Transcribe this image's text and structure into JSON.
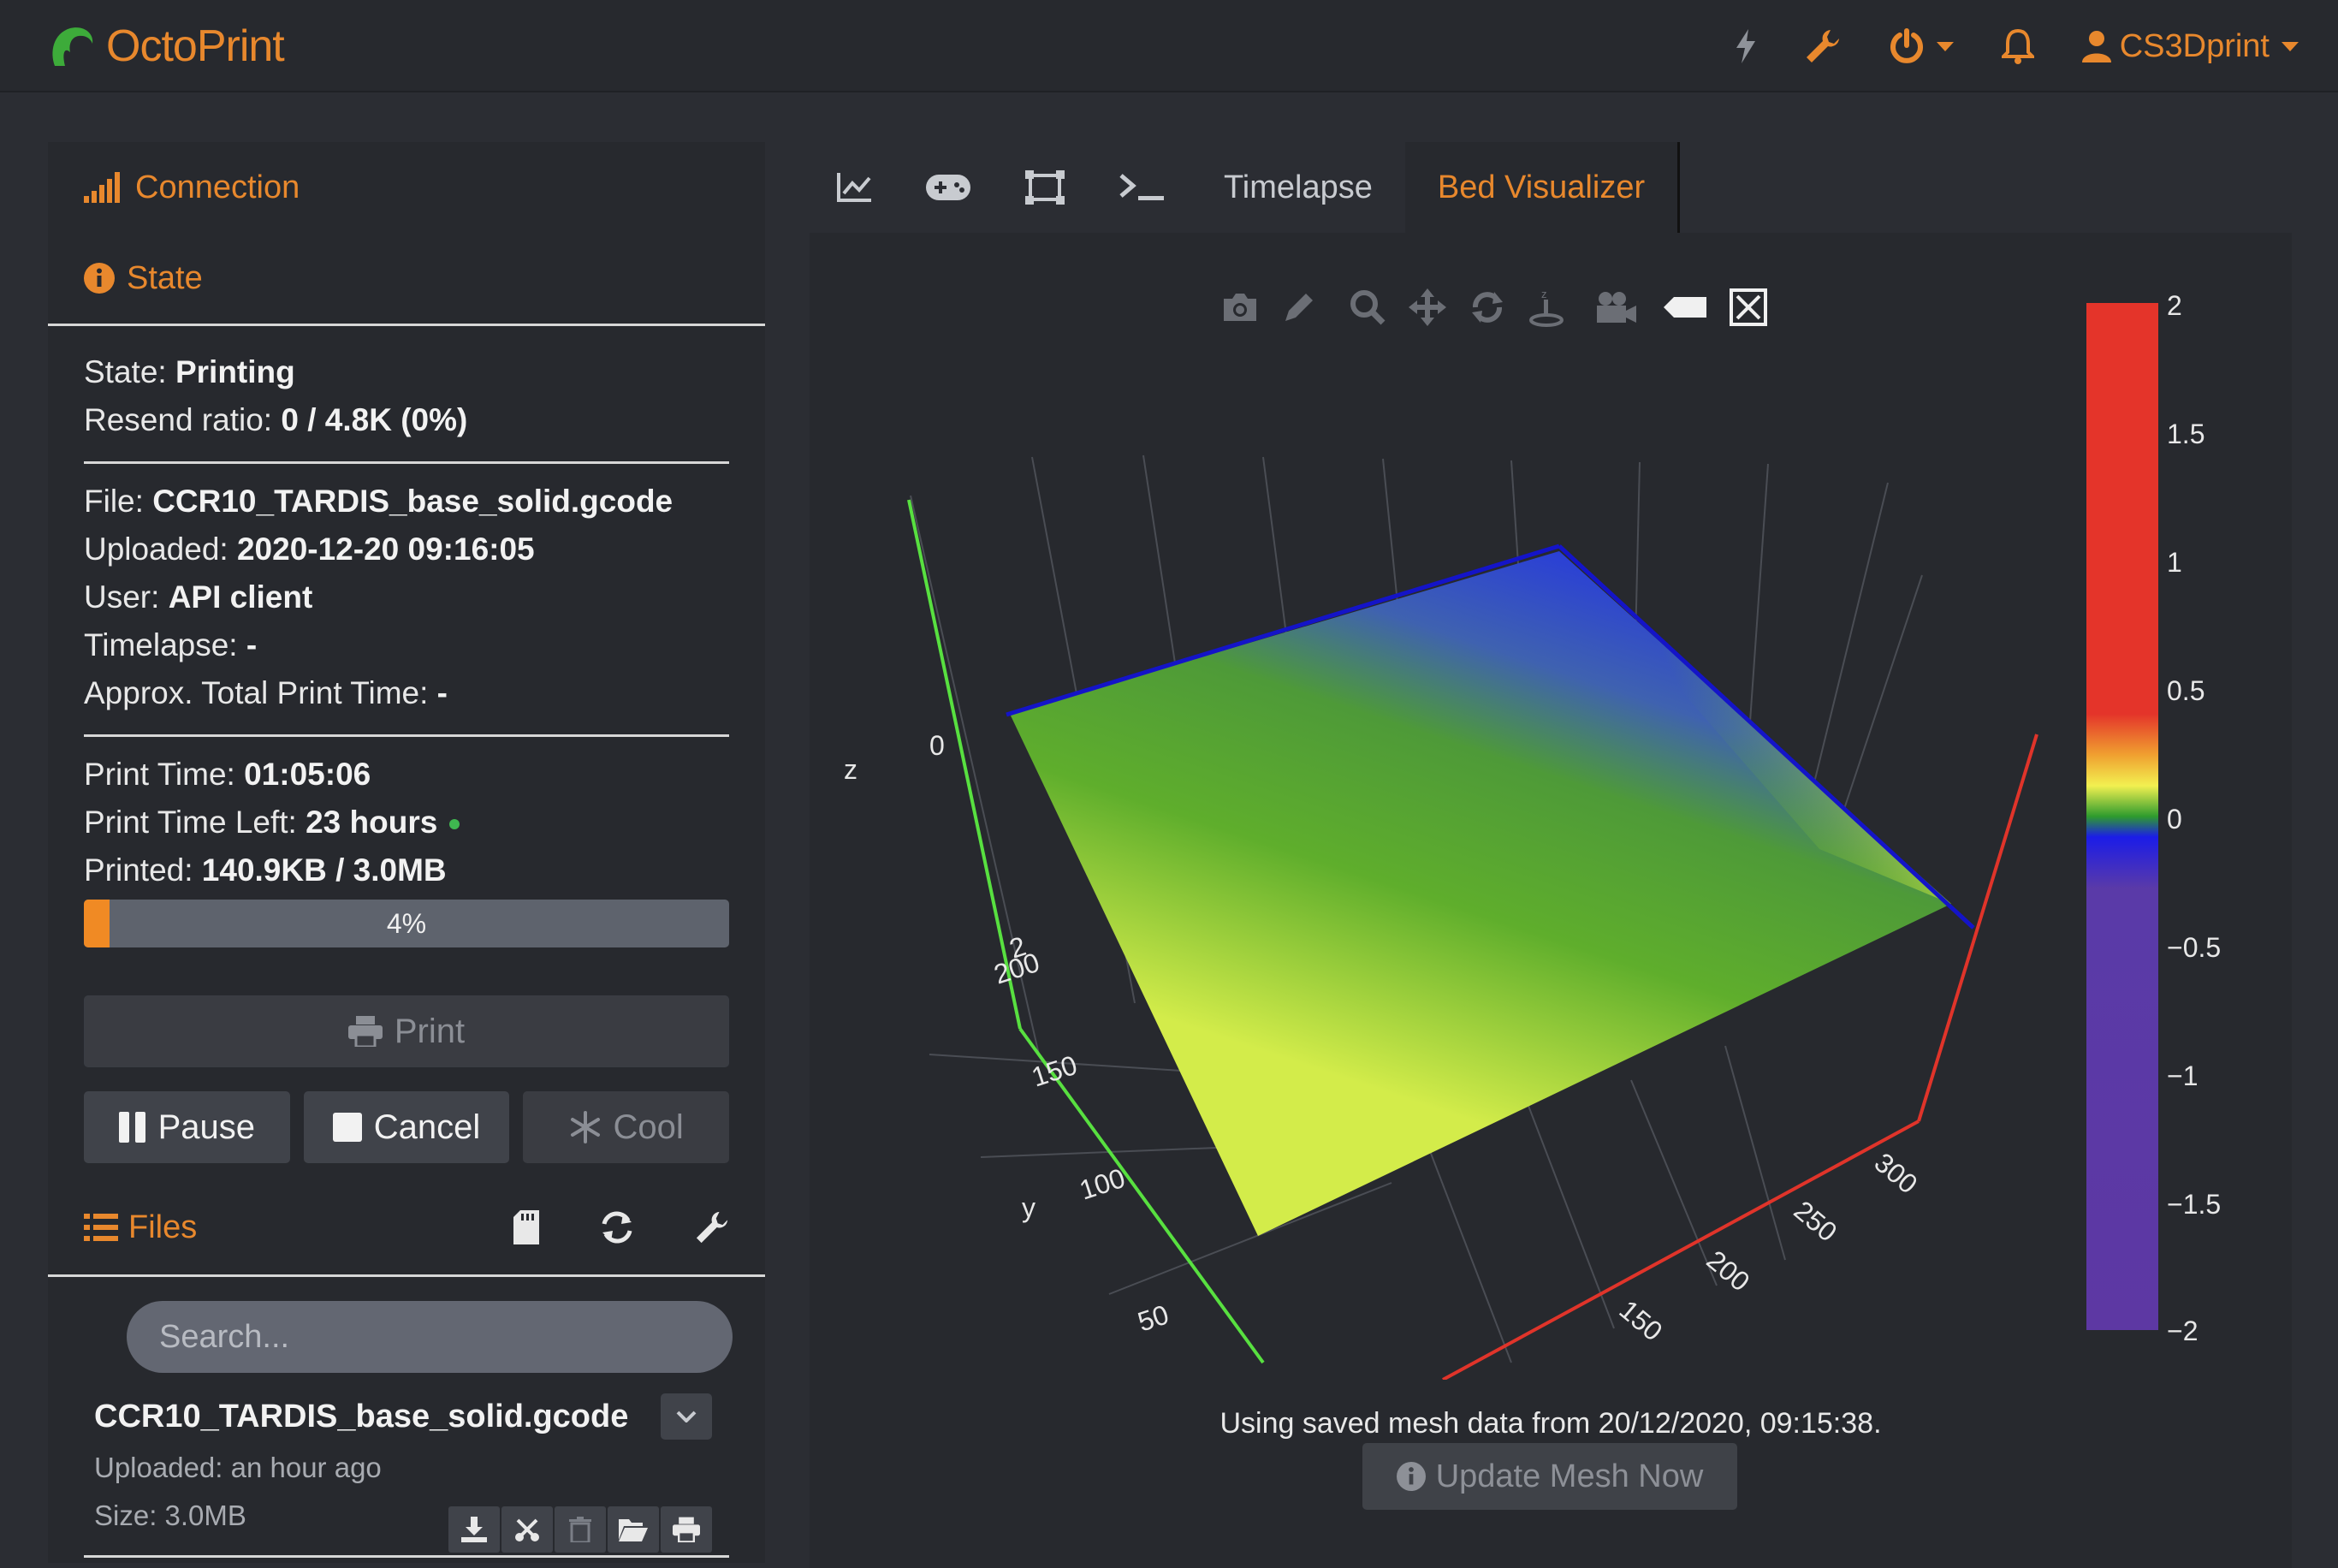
{
  "brand": {
    "name": "OctoPrint"
  },
  "navbar": {
    "icons": [
      "lightning-icon",
      "wrench-icon",
      "power-icon",
      "bell-icon"
    ],
    "user": "CS3Dprint",
    "accent": "#e8882d"
  },
  "sidebar": {
    "connection_title": "Connection",
    "state_title": "State",
    "state": {
      "state_label": "State:",
      "state_value": "Printing",
      "resend_label": "Resend ratio:",
      "resend_value": "0 / 4.8K (0%)",
      "file_label": "File:",
      "file_value": "CCR10_TARDIS_base_solid.gcode",
      "uploaded_label": "Uploaded:",
      "uploaded_value": "2020-12-20 09:16:05",
      "user_label": "User:",
      "user_value": "API client",
      "timelapse_label": "Timelapse:",
      "timelapse_value": "-",
      "approx_label": "Approx. Total Print Time:",
      "approx_value": "-",
      "printtime_label": "Print Time:",
      "printtime_value": "01:05:06",
      "timeleft_label": "Print Time Left:",
      "timeleft_value": "23 hours",
      "printed_label": "Printed:",
      "printed_value": "140.9KB / 3.0MB",
      "progress_text": "4%",
      "progress_fraction": 0.04
    },
    "buttons": {
      "print": "Print",
      "pause": "Pause",
      "cancel": "Cancel",
      "cool": "Cool"
    },
    "files": {
      "title": "Files",
      "search_placeholder": "Search...",
      "items": [
        {
          "name": "CCR10_TARDIS_base_solid.gcode",
          "uploaded": "Uploaded: an hour ago",
          "size": "Size: 3.0MB"
        }
      ]
    }
  },
  "tabs": {
    "icon_tabs": [
      "graph-icon",
      "gamepad-icon",
      "crop-icon",
      "terminal-icon"
    ],
    "timelapse": "Timelapse",
    "bed_visualizer": "Bed Visualizer"
  },
  "visualizer": {
    "caption": "Using saved mesh data from 20/12/2020, 09:15:38.",
    "update_button": "Update Mesh Now",
    "axis_z": "z",
    "axis_y": "y",
    "z_tick_top": "0",
    "z_tick_low": "2",
    "y_ticks": [
      "200",
      "150",
      "100",
      "50"
    ],
    "x_ticks": [
      "300",
      "250",
      "200",
      "150"
    ],
    "colorbar_ticks": [
      "2",
      "1.5",
      "1",
      "0.5",
      "0",
      "−0.5",
      "−1",
      "−1.5",
      "−2"
    ]
  }
}
